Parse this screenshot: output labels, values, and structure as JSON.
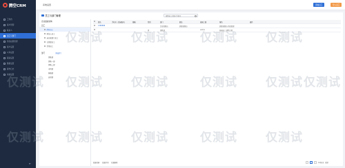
{
  "brand": {
    "name": "腾空CRM"
  },
  "topbar": {
    "breadcrumb": "系统设置",
    "primary_btn": "添加员工",
    "secondary_btn": "导入员工"
  },
  "sidebar": {
    "items": [
      {
        "label": "工作台"
      },
      {
        "label": "客户管理"
      },
      {
        "label": "联系人"
      },
      {
        "label": "员工与部门",
        "active": true
      },
      {
        "label": "角色权限管理"
      },
      {
        "label": "客户设置"
      },
      {
        "label": "公海设置"
      },
      {
        "label": "跟进设置"
      },
      {
        "label": "数据设置"
      },
      {
        "label": "操作日志"
      },
      {
        "label": "系统设置"
      }
    ]
  },
  "card": {
    "title": "员工与部门管理",
    "search_placeholder": "搜索员工姓名/手机号"
  },
  "tree": {
    "company": "企业组织架构",
    "section_staff": "员工",
    "staff_items": [
      {
        "label": "所有员工",
        "selected": true
      },
      {
        "label": "新加入员工"
      },
      {
        "label": "未分配部门员工"
      },
      {
        "label": "已离职员工"
      },
      {
        "label": "禁用员工"
      }
    ],
    "section_dept": "部门",
    "dept_add": "添加部门",
    "depts": [
      "销售部",
      "销售一部",
      "销售二部",
      "市场部",
      "客服部",
      "运营部"
    ]
  },
  "table": {
    "headers": [
      "",
      "姓名",
      "手机号（登录账号）",
      "邮箱",
      "性别",
      "部门",
      "职位",
      "直属上级",
      "角色",
      "操作"
    ],
    "rows": [
      [
        "",
        "1388888",
        "",
        "",
        "",
        "企业管理员",
        "超级管理员",
        "",
        "超级管理员,系统管理",
        ""
      ],
      [
        "",
        "",
        "",
        "",
        "男",
        "销售部",
        "",
        "admin",
        "普通员工,销售主管",
        ""
      ]
    ]
  },
  "footer": {
    "actions": [
      "批量转移",
      "批量禁用",
      "批量删除"
    ],
    "pages": [
      "‹",
      "1",
      "›"
    ],
    "page_size": "10条/页",
    "goto": "跳至"
  },
  "watermark": "仅测试"
}
